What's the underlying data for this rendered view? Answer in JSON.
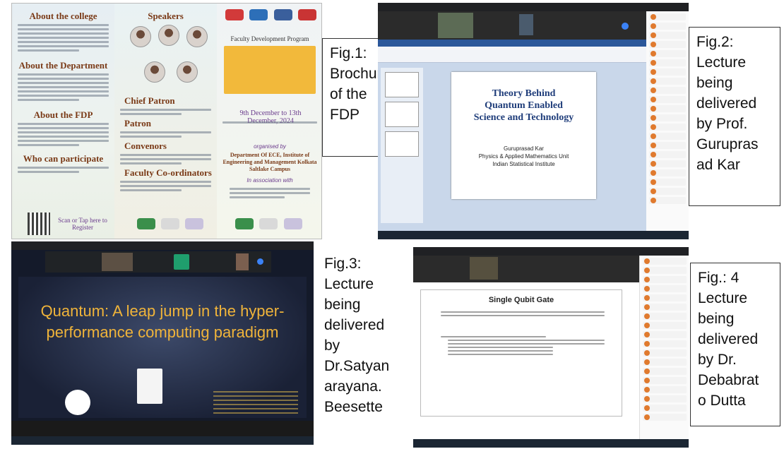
{
  "captions": {
    "fig1": [
      "Fig.1:",
      "Brochure",
      "of the",
      "FDP"
    ],
    "fig2": [
      "Fig.2:",
      "Lecture",
      "being",
      "delivered",
      "by Prof.",
      "Gurupras",
      "ad Kar"
    ],
    "fig3": [
      "Fig.3:",
      "Lecture",
      "being",
      "delivered",
      "by",
      "Dr.Satyan",
      "arayana.",
      "Beesette"
    ],
    "fig4": [
      "Fig.: 4",
      "Lecture",
      "being",
      "delivered",
      "by Dr.",
      "Debabrat",
      "o Dutta"
    ]
  },
  "brochure": {
    "about_college": "About the college",
    "about_department": "About the Department",
    "about_fdp": "About the FDP",
    "who_can": "Who can participate",
    "scan": "Scan or Tap here to Register",
    "speakers": "Speakers",
    "chief_patron": "Chief Patron",
    "patron": "Patron",
    "convenors": "Convenors",
    "faculty_coord": "Faculty Co-ordinators",
    "program": "Faculty Development Program",
    "dates": "9th December to 13th December, 2024",
    "organised": "organised by",
    "dept": "Department Of ECE, Institute of Engineering and Management Kolkata Saltlake Campus",
    "association": "In association with"
  },
  "slide2": {
    "title_lines": [
      "Theory Behind",
      "Quantum Enabled",
      "Science and Technology"
    ],
    "presenter": "Guruprasad Kar",
    "unit": "Physics & Applied Mathematics Unit",
    "institute": "Indian Statistical Institute"
  },
  "slide3": {
    "title_lines": [
      "Quantum: A leap jump in the hyper-",
      "performance computing paradigm"
    ]
  },
  "slide4": {
    "title": "Single Qubit Gate"
  },
  "colors": {
    "brochure_heading": "#7a3a17",
    "quantum_box": "#f2b93b",
    "slide3_text": "#f0b43a",
    "slide2_title": "#1f3d7a"
  }
}
